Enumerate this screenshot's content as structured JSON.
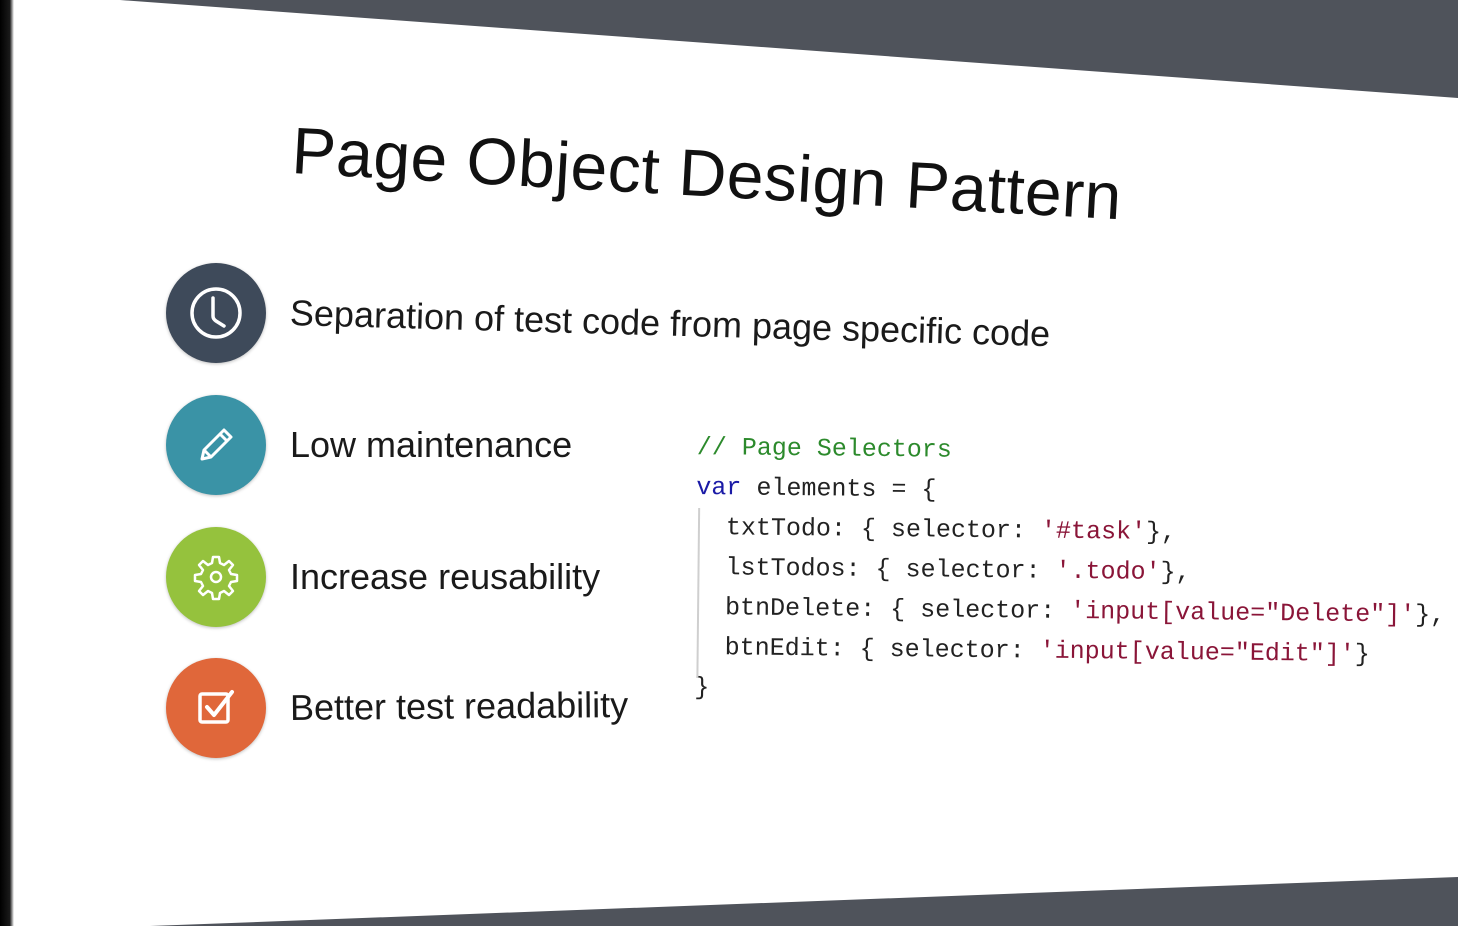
{
  "slide": {
    "title": "Page Object Design Pattern",
    "bullets": [
      {
        "text": "Separation of test code from page specific code",
        "icon": "clock-icon",
        "color": "#3e4a5a"
      },
      {
        "text": "Low maintenance",
        "icon": "pencil-icon",
        "color": "#3a93a6"
      },
      {
        "text": "Increase reusability",
        "icon": "gear-icon",
        "color": "#95c23d"
      },
      {
        "text": "Better test readability",
        "icon": "checkbox-icon",
        "color": "#e0673a"
      }
    ],
    "code": {
      "comment": "// Page Selectors",
      "kw_var": "var",
      "decl_rest": " elements = {",
      "entries": [
        {
          "key": "  txtTodo: { selector: ",
          "value": "'#task'",
          "tail": "},"
        },
        {
          "key": "  lstTodos: { selector: ",
          "value": "'.todo'",
          "tail": "},"
        },
        {
          "key": "  btnDelete: { selector: ",
          "value": "'input[value=\"Delete\"]'",
          "tail": "},"
        },
        {
          "key": "  btnEdit: { selector: ",
          "value": "'input[value=\"Edit\"]'",
          "tail": "}"
        }
      ],
      "close": "}"
    }
  }
}
